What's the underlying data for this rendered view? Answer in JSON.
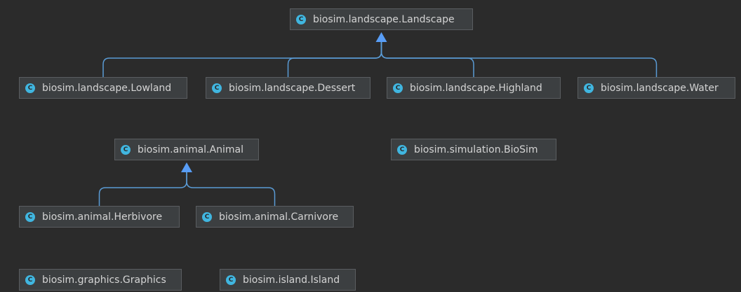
{
  "diagram": {
    "icon_glyph": "C",
    "nodes": [
      {
        "id": "landscape",
        "label": "biosim.landscape.Landscape"
      },
      {
        "id": "lowland",
        "label": "biosim.landscape.Lowland"
      },
      {
        "id": "dessert",
        "label": "biosim.landscape.Dessert"
      },
      {
        "id": "highland",
        "label": "biosim.landscape.Highland"
      },
      {
        "id": "water",
        "label": "biosim.landscape.Water"
      },
      {
        "id": "animal",
        "label": "biosim.animal.Animal"
      },
      {
        "id": "biosim-sim",
        "label": "biosim.simulation.BioSim"
      },
      {
        "id": "herbivore",
        "label": "biosim.animal.Herbivore"
      },
      {
        "id": "carnivore",
        "label": "biosim.animal.Carnivore"
      },
      {
        "id": "graphics",
        "label": "biosim.graphics.Graphics"
      },
      {
        "id": "island",
        "label": "biosim.island.Island"
      }
    ],
    "edges": [
      {
        "from": "lowland",
        "to": "landscape"
      },
      {
        "from": "dessert",
        "to": "landscape"
      },
      {
        "from": "highland",
        "to": "landscape"
      },
      {
        "from": "water",
        "to": "landscape"
      },
      {
        "from": "herbivore",
        "to": "animal"
      },
      {
        "from": "carnivore",
        "to": "animal"
      }
    ],
    "colors": {
      "background": "#2b2b2b",
      "node_fill": "#3c3f41",
      "node_border": "#5a5d60",
      "text": "#d4d4d4",
      "class_icon": "#40b6e0",
      "edge": "#5a9bd5",
      "arrowhead": "#589df6"
    }
  }
}
